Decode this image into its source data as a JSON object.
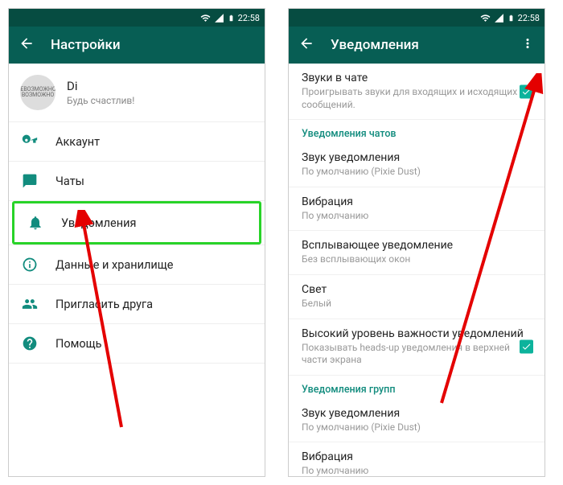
{
  "statusbar": {
    "time": "22:58"
  },
  "left": {
    "title": "Настройки",
    "profile": {
      "name": "Di",
      "status": "Будь счастлив!",
      "avatar_text": "НЕВОЗМОЖНОЕ ВОЗМОЖНО"
    },
    "items": [
      {
        "icon": "key-icon",
        "label": "Аккаунт"
      },
      {
        "icon": "chat-icon",
        "label": "Чаты"
      },
      {
        "icon": "bell-icon",
        "label": "Уведомления",
        "highlighted": true
      },
      {
        "icon": "data-icon",
        "label": "Данные и хранилище"
      },
      {
        "icon": "people-icon",
        "label": "Пригласить друга"
      },
      {
        "icon": "help-icon",
        "label": "Помощь"
      }
    ]
  },
  "right": {
    "title": "Уведомления",
    "items": [
      {
        "type": "setting",
        "title": "Звуки в чате",
        "sub": "Проигрывать звуки для входящих и исходящих сообщений.",
        "checked": true
      },
      {
        "type": "header",
        "title": "Уведомления чатов"
      },
      {
        "type": "setting",
        "title": "Звук уведомления",
        "sub": "По умолчанию (Pixie Dust)"
      },
      {
        "type": "setting",
        "title": "Вибрация",
        "sub": "По умолчанию"
      },
      {
        "type": "setting",
        "title": "Всплывающее уведомление",
        "sub": "Без всплывающих окон"
      },
      {
        "type": "setting",
        "title": "Свет",
        "sub": "Белый"
      },
      {
        "type": "setting",
        "title": "Высокий уровень важности уведомлений",
        "sub": "Показывать heads-up уведомления в верхней части экрана",
        "checked": true
      },
      {
        "type": "header",
        "title": "Уведомления групп"
      },
      {
        "type": "setting",
        "title": "Звук уведомления",
        "sub": "По умолчанию (Pixie Dust)"
      },
      {
        "type": "setting",
        "title": "Вибрация",
        "sub": "По умолчанию"
      }
    ]
  }
}
